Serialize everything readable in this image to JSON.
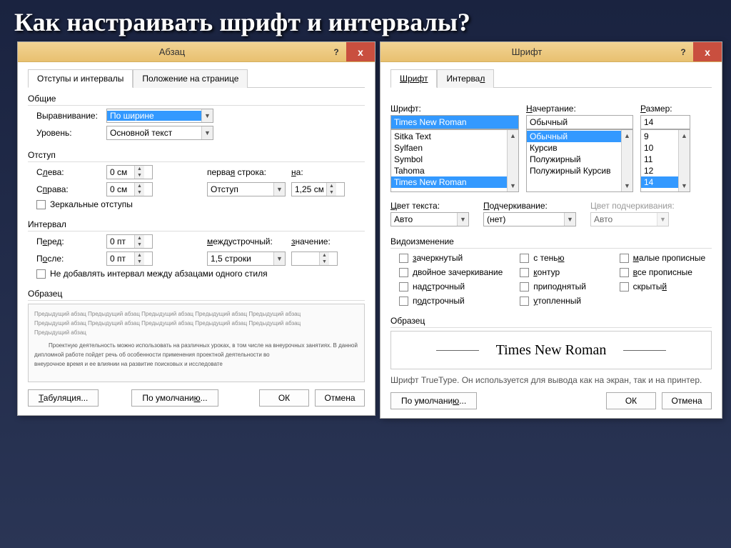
{
  "page": {
    "title": "Как настраивать шрифт и интервалы?"
  },
  "paragraphDialog": {
    "title": "Абзац",
    "help": "?",
    "close": "x",
    "tabs": {
      "indentation": "Отступы и интервалы",
      "position": "Положение на странице"
    },
    "general": {
      "label": "Общие",
      "alignmentLabel": "Выравнивание:",
      "alignmentValue": "По ширине",
      "levelLabel": "Уровень:",
      "levelValue": "Основной текст"
    },
    "indent": {
      "label": "Отступ",
      "leftLabel": "Слева:",
      "leftValue": "0 см",
      "rightLabel": "Справа:",
      "rightValue": "0 см",
      "firstLineLabel": "первая строка:",
      "firstLineValue": "Отступ",
      "byLabel": "на:",
      "byValue": "1,25 см",
      "mirrorLabel": "Зеркальные отступы"
    },
    "spacing": {
      "label": "Интервал",
      "beforeLabel": "Перед:",
      "beforeValue": "0 пт",
      "afterLabel": "После:",
      "afterValue": "0 пт",
      "lineLabel": "междустрочный:",
      "lineValue": "1,5 строки",
      "atLabel": "значение:",
      "atValue": "",
      "dontAddLabel": "Не добавлять интервал между абзацами одного стиля"
    },
    "preview": {
      "label": "Образец",
      "text1": "Предыдущий абзац Предыдущий абзац Предыдущий абзац Предыдущий абзац Предыдущий абзац",
      "text2": "Предыдущий абзац Предыдущий абзац Предыдущий абзац Предыдущий абзац Предыдущий абзац",
      "text3": "Предыдущий абзац",
      "text4": "Проектную деятельность можно использовать на различных уроках, в том числе на внеурочных занятиях. В данной дипломной работе пойдет речь об особенности применения проектной деятельности во",
      "text5": "внеурочное время и ее влиянии на развитие поисковых и исследовате"
    },
    "buttons": {
      "tabs": "Табуляция...",
      "default": "По умолчанию...",
      "ok": "ОК",
      "cancel": "Отмена"
    }
  },
  "fontDialog": {
    "title": "Шрифт",
    "help": "?",
    "close": "x",
    "tabs": {
      "font": "Шрифт",
      "spacing": "Интервал"
    },
    "font": {
      "nameLabel": "Шрифт:",
      "nameValue": "Times New Roman",
      "nameList": [
        "Sitka Text",
        "Sylfaen",
        "Symbol",
        "Tahoma",
        "Times New Roman"
      ],
      "styleLabel": "Начертание:",
      "styleValue": "Обычный",
      "styleList": [
        "Обычный",
        "Курсив",
        "Полужирный",
        "Полужирный Курсив"
      ],
      "sizeLabel": "Размер:",
      "sizeValue": "14",
      "sizeList": [
        "9",
        "10",
        "11",
        "12",
        "14"
      ]
    },
    "colorRow": {
      "colorLabel": "Цвет текста:",
      "colorValue": "Авто",
      "underlineLabel": "Подчеркивание:",
      "underlineValue": "(нет)",
      "underlineColorLabel": "Цвет подчеркивания:",
      "underlineColorValue": "Авто"
    },
    "effects": {
      "label": "Видоизменение",
      "col1": [
        "зачеркнутый",
        "двойное зачеркивание",
        "надстрочный",
        "подстрочный"
      ],
      "col2": [
        "с тенью",
        "контур",
        "приподнятый",
        "утопленный"
      ],
      "col3": [
        "малые прописные",
        "все прописные",
        "скрытый"
      ]
    },
    "preview": {
      "label": "Образец",
      "sample": "Times New Roman",
      "info": "Шрифт TrueType. Он используется для вывода как на экран, так и на принтер."
    },
    "buttons": {
      "default": "По умолчанию...",
      "ok": "ОК",
      "cancel": "Отмена"
    }
  }
}
